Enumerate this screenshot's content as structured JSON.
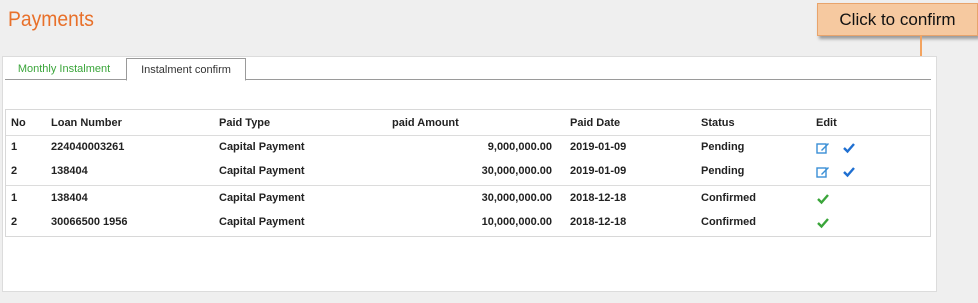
{
  "page": {
    "title": "Payments"
  },
  "callout": {
    "text": "Click to confirm"
  },
  "tabs": [
    {
      "label": "Monthly Instalment",
      "active": false
    },
    {
      "label": "Instalment confirm",
      "active": true
    }
  ],
  "table": {
    "headers": [
      "No",
      "Loan Number",
      "Paid Type",
      "paid Amount",
      "Paid Date",
      "Status",
      "Edit"
    ],
    "rows": [
      {
        "no": "1",
        "loan": "224040003261",
        "type": "Capital Payment",
        "amount": "9,000,000.00",
        "date": "2019-01-09",
        "status": "Pending",
        "edit": [
          "edit-icon",
          "check-icon"
        ]
      },
      {
        "no": "2",
        "loan": "138404",
        "type": "Capital Payment",
        "amount": "30,000,000.00",
        "date": "2019-01-09",
        "status": "Pending",
        "edit": [
          "edit-icon",
          "check-icon"
        ]
      },
      {
        "no": "1",
        "loan": "138404",
        "type": "Capital Payment",
        "amount": "30,000,000.00",
        "date": "2018-12-18",
        "status": "Confirmed",
        "edit": [
          "confirmed-check-icon"
        ]
      },
      {
        "no": "2",
        "loan": "30066500 1956",
        "type": "Capital Payment",
        "amount": "10,000,000.00",
        "date": "2018-12-18",
        "status": "Confirmed",
        "edit": [
          "confirmed-check-icon"
        ]
      }
    ]
  },
  "colors": {
    "title": "#e8702a",
    "tab_active_text": "#3aa53a",
    "edit_icon": "#3a8fd6",
    "confirm_check": "#1f6fd1",
    "confirmed_check": "#3aa53a",
    "callout_bg": "#f6c9a0",
    "arrow": "#f3a35f"
  }
}
